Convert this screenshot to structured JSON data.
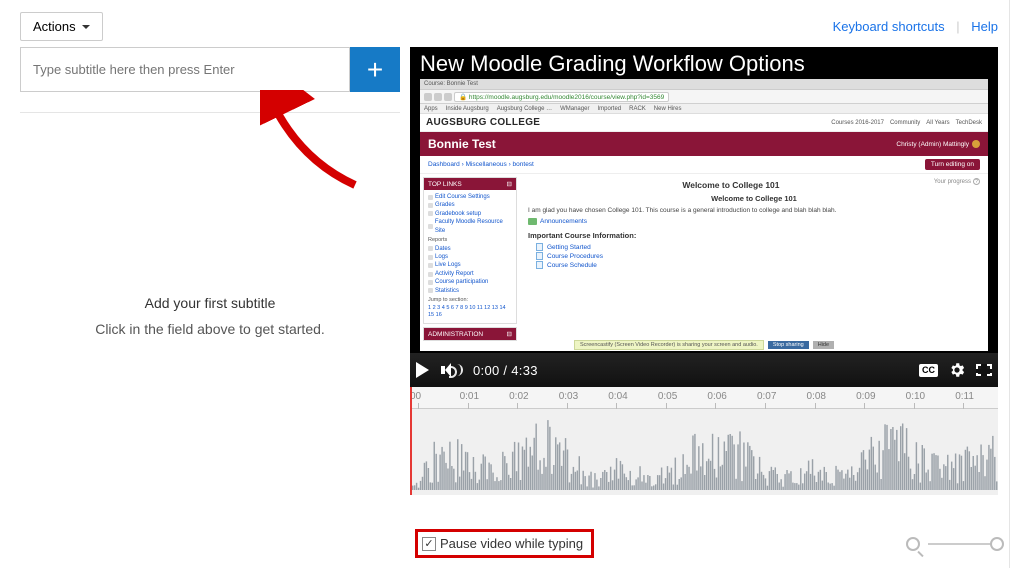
{
  "header": {
    "actions_label": "Actions",
    "keyboard_shortcuts": "Keyboard shortcuts",
    "help": "Help"
  },
  "subtitle_input": {
    "placeholder": "Type subtitle here then press Enter",
    "add_label": "+"
  },
  "placeholder": {
    "line1": "Add your first subtitle",
    "line2": "Click in the field above to get started."
  },
  "video": {
    "title": "New Moodle Grading Workflow Options",
    "url": "https://moodle.augsburg.edu/moodle2016/course/view.php?id=3569",
    "tab": "Course: Bonnie Test",
    "bookmarks": [
      "Apps",
      "Inside Augsburg",
      "Augsburg College …",
      "WManager",
      "Imported",
      "RACK",
      "New Hires"
    ],
    "college_logo": "AUGSBURG COLLEGE",
    "header_links": [
      "Courses 2016-2017",
      "Community",
      "All Years",
      "TechDesk"
    ],
    "course_name": "Bonnie Test",
    "user_name": "Christy (Admin) Mattingly",
    "crumbs": "Dashboard  ›  Miscellaneous  ›  bontest",
    "edit_btn": "Turn editing on",
    "side_toplinks_head": "TOP LINKS",
    "side_toplinks": [
      "Edit Course Settings",
      "Grades",
      "Gradebook setup",
      "Faculty Moodle Resource Site"
    ],
    "side_reports_label": "Reports",
    "side_reports": [
      "Dates",
      "Logs",
      "Live Logs",
      "Activity Report",
      "Course participation",
      "Statistics"
    ],
    "side_jump_label": "Jump to section:",
    "side_jump_links": "1 2 3 4 5 6 7 8 9 10 11 12 13 14 15 16",
    "side_admin_head": "ADMINISTRATION",
    "main_progress": "Your progress",
    "main_h3": "Welcome to College 101",
    "main_h4": "Welcome to College 101",
    "main_p": "I am glad you have chosen College 101. This course is a general introduction to college and blah blah blah.",
    "main_anns": "Announcements",
    "main_strong": "Important Course Information:",
    "docs": [
      "Getting Started",
      "Course Procedures",
      "Course Schedule"
    ],
    "recorder_msg": "Screencastify (Screen Video Recorder) is sharing your screen and audio.",
    "recorder_stop": "Stop sharing",
    "recorder_hide": "Hide",
    "current_time": "0:00",
    "duration": "4:33",
    "cc": "CC"
  },
  "timeline": {
    "ticks": [
      "00",
      "0:01",
      "0:02",
      "0:03",
      "0:04",
      "0:05",
      "0:06",
      "0:07",
      "0:08",
      "0:09",
      "0:10",
      "0:11"
    ]
  },
  "footer": {
    "pause_label": "Pause video while typing",
    "pause_checked": true
  }
}
